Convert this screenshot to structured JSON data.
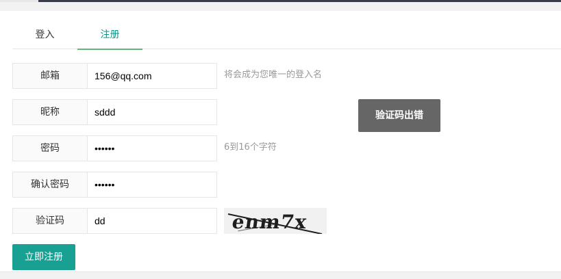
{
  "tabs": [
    {
      "label": "登入"
    },
    {
      "label": "注册"
    }
  ],
  "form": {
    "email": {
      "label": "邮箱",
      "value": "156@qq.com",
      "hint": "将会成为您唯一的登入名"
    },
    "nickname": {
      "label": "昵称",
      "value": "sddd"
    },
    "password": {
      "label": "密码",
      "value": "••••••",
      "hint": "6到16个字符"
    },
    "confirm_password": {
      "label": "确认密码",
      "value": "••••••"
    },
    "captcha": {
      "label": "验证码",
      "value": "dd",
      "image_text": "enm7x"
    }
  },
  "error_message": "验证码出错",
  "submit_label": "立即注册",
  "colors": {
    "accent": "#009688",
    "tab_underline": "#5fb878",
    "error_bg": "#666666"
  }
}
